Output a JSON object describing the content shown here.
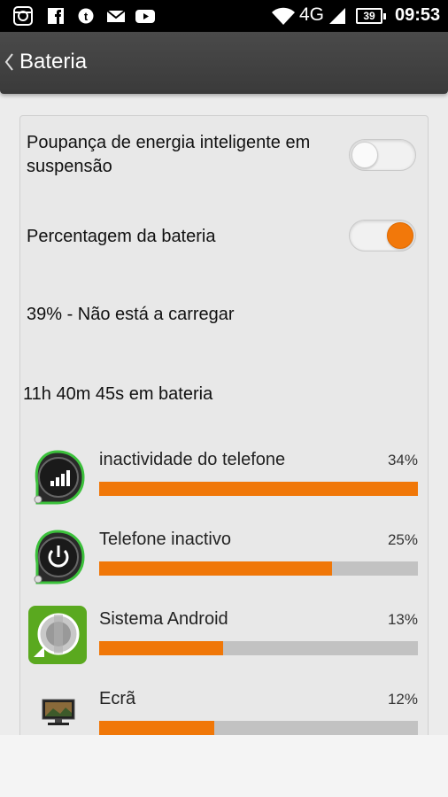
{
  "status_bar": {
    "network": "4G",
    "battery_level": "39",
    "time": "09:53",
    "left_icons": [
      "instagram-icon",
      "facebook-icon",
      "messenger-icon",
      "mail-icon",
      "youtube-icon"
    ]
  },
  "header": {
    "title": "Bateria"
  },
  "settings": {
    "smart_saving_label": "Poupança de energia inteligente em suspensão",
    "smart_saving_on": false,
    "battery_percentage_label": "Percentagem da bateria",
    "battery_percentage_on": true,
    "battery_status": "39% - Não está a carregar",
    "time_on_battery": "11h 40m 45s em bateria"
  },
  "usage": [
    {
      "label": "inactividade do telefone",
      "percent_text": "34%",
      "fraction": 1.0,
      "icon": "signal-cell-icon"
    },
    {
      "label": "Telefone inactivo",
      "percent_text": "25%",
      "fraction": 0.73,
      "icon": "power-icon"
    },
    {
      "label": "Sistema Android",
      "percent_text": "13%",
      "fraction": 0.39,
      "icon": "android-system-icon"
    },
    {
      "label": "Ecrã",
      "percent_text": "12%",
      "fraction": 0.36,
      "icon": "screen-icon"
    }
  ],
  "colors": {
    "accent": "#f07708",
    "track": "#c2c2c2",
    "header": "#3f3f3f"
  }
}
